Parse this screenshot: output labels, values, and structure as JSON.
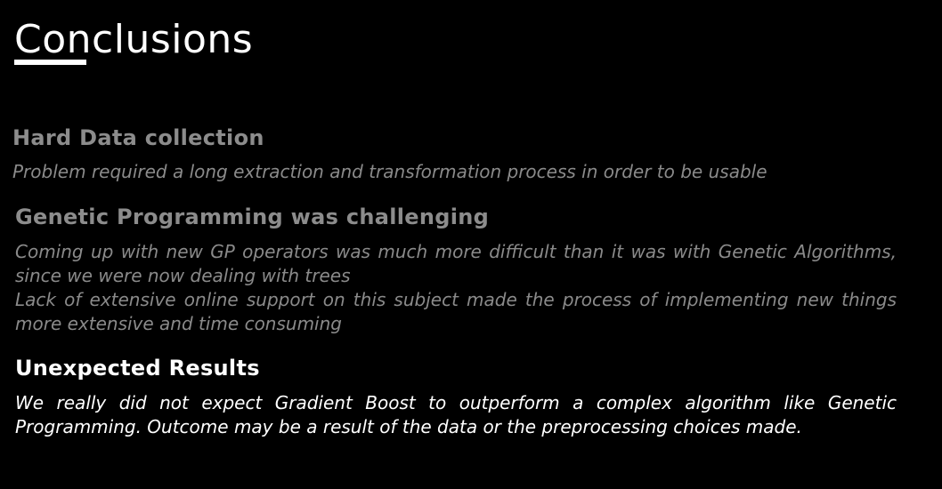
{
  "slide": {
    "title": "Conclusions"
  },
  "sections": [
    {
      "heading": "Hard Data collection",
      "paragraphs": [
        "Problem required a long extraction and transformation process in order to be usable"
      ]
    },
    {
      "heading": "Genetic Programming was challenging",
      "paragraphs": [
        "Coming up with new GP operators was much more difficult than it was with Genetic Algorithms, since we were now dealing with trees",
        "Lack of extensive online support on this subject made the process of implementing new things more extensive and time consuming"
      ]
    },
    {
      "heading": "Unexpected Results",
      "paragraphs": [
        "We really did not expect Gradient Boost to outperform a complex algorithm like Genetic Programming. Outcome may be a result of the data or the preprocessing choices made."
      ]
    }
  ],
  "colors": {
    "background": "#000000",
    "title": "#ffffff",
    "dim_text": "#8a8a8a",
    "highlight_text": "#ffffff"
  }
}
